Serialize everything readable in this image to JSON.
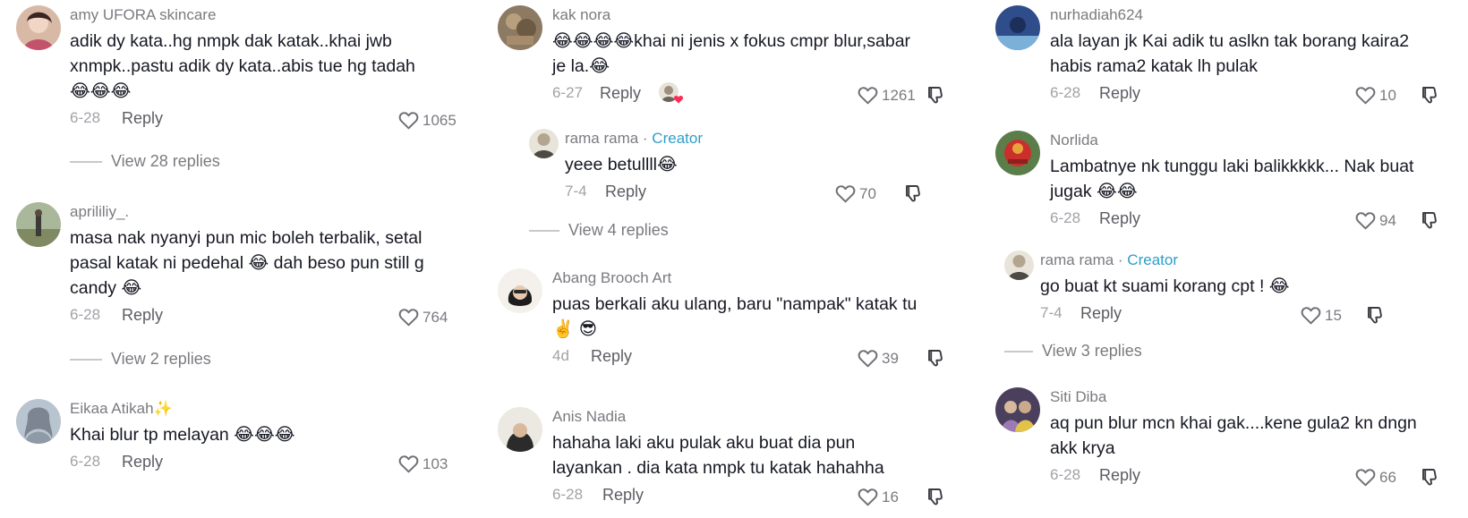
{
  "colors": {
    "creator": "#2d9ec9",
    "muted": "#7a7b80",
    "text": "#161823",
    "heart": "#7a7b80"
  },
  "col1": {
    "c1": {
      "username": "amy UFORA skincare",
      "line1": "adik dy kata..hg nmpk dak katak..khai jwb",
      "line2": "xnmpk..pastu adik dy kata..abis tue hg tadah",
      "line3": "😂😂😂",
      "date": "6-28",
      "reply": "Reply",
      "likes": "1065",
      "view_replies": "View 28 replies"
    },
    "c2": {
      "username": "aprililiy_.",
      "line1": "masa nak nyanyi pun mic boleh terbalik, setal",
      "line2": "pasal katak ni pedehal 😂 dah beso pun still g",
      "line3": "candy 😂",
      "date": "6-28",
      "reply": "Reply",
      "likes": "764",
      "view_replies": "View 2 replies"
    },
    "c3": {
      "username": "Eikaa Atikah",
      "username_emoji": "✨",
      "line1": "Khai blur tp melayan 😂😂😂",
      "date": "6-28",
      "reply": "Reply",
      "likes": "103"
    }
  },
  "col2": {
    "c1": {
      "username": "kak nora",
      "line1": "😂😂😂😂khai ni jenis x fokus cmpr blur,sabar",
      "line2": "je la.😂",
      "date": "6-27",
      "reply": "Reply",
      "likes": "1261"
    },
    "r1": {
      "username": "rama rama",
      "creator": "Creator",
      "line1": "yeee betullll😂",
      "date": "7-4",
      "reply": "Reply",
      "likes": "70",
      "view_replies": "View 4 replies"
    },
    "c2": {
      "username": "Abang Brooch Art",
      "line1": "puas berkali aku ulang, baru \"nampak\" katak tu",
      "line2": "✌️ 😎",
      "date": "4d",
      "reply": "Reply",
      "likes": "39"
    },
    "c3": {
      "username": "Anis Nadia",
      "line1": "hahaha laki aku pulak aku buat dia pun",
      "line2": "layankan . dia kata nmpk tu katak hahahha",
      "date": "6-28",
      "reply": "Reply",
      "likes": "16"
    }
  },
  "col3": {
    "c1": {
      "username": "nurhadiah624",
      "line1": "ala layan jk Kai adik tu aslkn tak borang kaira2",
      "line2": "habis rama2 katak lh pulak",
      "date": "6-28",
      "reply": "Reply",
      "likes": "10"
    },
    "c2": {
      "username": "Norlida",
      "line1": "Lambatnye nk tunggu laki balikkkkk... Nak buat",
      "line2": "jugak 😂😂",
      "date": "6-28",
      "reply": "Reply",
      "likes": "94"
    },
    "r1": {
      "username": "rama rama",
      "creator": "Creator",
      "line1": "go buat kt suami korang cpt ! 😂",
      "date": "7-4",
      "reply": "Reply",
      "likes": "15",
      "view_replies": "View 3 replies"
    },
    "c3": {
      "username": "Siti Diba",
      "line1": "aq pun blur mcn khai gak....kene gula2 kn dngn",
      "line2": "akk krya",
      "date": "6-28",
      "reply": "Reply",
      "likes": "66"
    }
  }
}
